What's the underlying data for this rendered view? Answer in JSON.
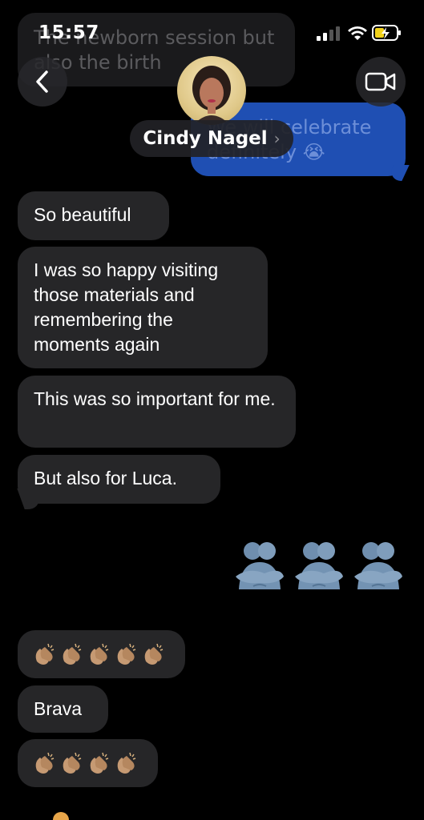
{
  "status_bar": {
    "time": "15:57"
  },
  "header": {
    "contact_name": "Cindy Nagel",
    "chevron": "›",
    "back_icon": "chevron-left-icon",
    "video_icon": "video-camera-icon"
  },
  "scrolled_messages": {
    "incoming": "The newborn session but also the birth",
    "outgoing": "We will celebrate definitely 😭"
  },
  "messages": [
    {
      "direction": "incoming",
      "text": "So beautiful"
    },
    {
      "direction": "incoming",
      "text": "I was so happy visiting those materials and remembering the moments again"
    },
    {
      "direction": "incoming",
      "text": "This was so important for me."
    },
    {
      "direction": "incoming",
      "text": "But also for Luca."
    },
    {
      "direction": "outgoing",
      "emoji": "people-hugging",
      "count": 3
    },
    {
      "direction": "incoming",
      "emoji": "clapping-hands",
      "count": 5
    },
    {
      "direction": "incoming",
      "text": "Brava"
    },
    {
      "direction": "incoming",
      "emoji": "clapping-hands",
      "count": 4
    }
  ],
  "colors": {
    "incoming_bubble": "#262628",
    "outgoing_bubble": "#1f4fb3",
    "background": "#000000"
  }
}
